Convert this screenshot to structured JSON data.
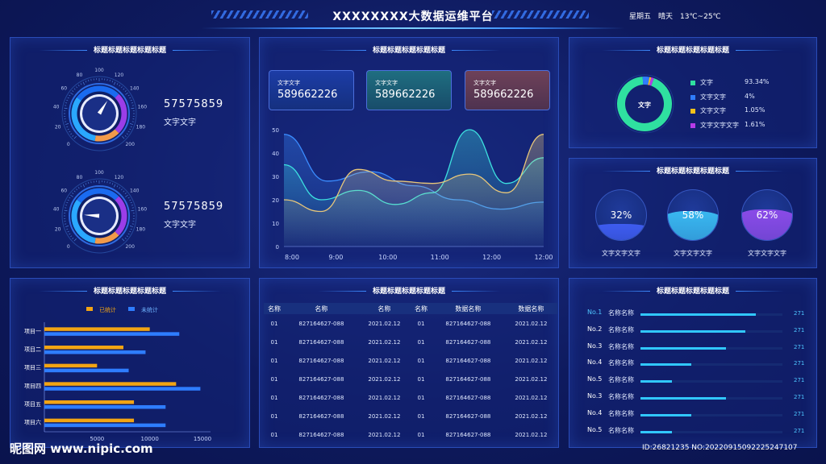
{
  "header": {
    "title": "XXXXXXXX大数据运维平台",
    "date": "星期五　晴天　13℃~25℃"
  },
  "panels": {
    "gauges": {
      "title": "标题标题标题标题标题",
      "items": [
        {
          "value": "57575859",
          "label": "文字文字",
          "needle": 0.62
        },
        {
          "value": "57575859",
          "label": "文字文字",
          "needle": 0.18
        }
      ],
      "ticks": [
        "0",
        "20",
        "40",
        "60",
        "80",
        "100",
        "120",
        "140",
        "160",
        "180",
        "200"
      ]
    },
    "trend": {
      "title": "标题标题标题标题标题",
      "cards": [
        {
          "label": "文字文字",
          "value": "589662226",
          "color": "#1b3aa0"
        },
        {
          "label": "文字文字",
          "value": "589662226",
          "color": "#1c6d7a"
        },
        {
          "label": "文字文字",
          "value": "589662226",
          "color": "#6a3f55"
        }
      ]
    },
    "donut": {
      "title": "标题标题标题标题标题",
      "center": "文字"
    },
    "balls": {
      "title": "标题标题标题标题标题",
      "items": [
        {
          "pct": "32%",
          "value": 0.32,
          "label": "文字文字文字",
          "color": "#3e5cf0"
        },
        {
          "pct": "58%",
          "value": 0.58,
          "label": "文字文字文字",
          "color": "#39b8f0"
        },
        {
          "pct": "62%",
          "value": 0.62,
          "label": "文字文字文字",
          "color": "#8a4be8"
        }
      ]
    },
    "hbar": {
      "title": "标题标题标题标题标题"
    },
    "table": {
      "title": "标题标题标题标题标题",
      "headers": [
        "名称",
        "名称",
        "名称",
        "名称",
        "数据名称",
        "数据名称"
      ],
      "rows": [
        [
          "01",
          "827164627-088",
          "2021.02.12",
          "01",
          "827164627-088",
          "2021.02.12"
        ],
        [
          "01",
          "827164627-088",
          "2021.02.12",
          "01",
          "827164627-088",
          "2021.02.12"
        ],
        [
          "01",
          "827164627-088",
          "2021.02.12",
          "01",
          "827164627-088",
          "2021.02.12"
        ],
        [
          "01",
          "827164627-088",
          "2021.02.12",
          "01",
          "827164627-088",
          "2021.02.12"
        ],
        [
          "01",
          "827164627-088",
          "2021.02.12",
          "01",
          "827164627-088",
          "2021.02.12"
        ],
        [
          "01",
          "827164627-088",
          "2021.02.12",
          "01",
          "827164627-088",
          "2021.02.12"
        ],
        [
          "01",
          "827164627-088",
          "2021.02.12",
          "01",
          "827164627-088",
          "2021.02.12"
        ]
      ]
    },
    "ranking": {
      "title": "标题标题标题标题标题",
      "items": [
        {
          "rank": "No.1",
          "label": "名称名称",
          "value": "271",
          "fill": 0.81,
          "highlight": true
        },
        {
          "rank": "No.2",
          "label": "名称名称",
          "value": "271",
          "fill": 0.74,
          "highlight": false
        },
        {
          "rank": "No.3",
          "label": "名称名称",
          "value": "271",
          "fill": 0.6,
          "highlight": false
        },
        {
          "rank": "No.4",
          "label": "名称名称",
          "value": "271",
          "fill": 0.36,
          "highlight": false
        },
        {
          "rank": "No.5",
          "label": "名称名称",
          "value": "271",
          "fill": 0.22,
          "highlight": false
        },
        {
          "rank": "No.3",
          "label": "名称名称",
          "value": "271",
          "fill": 0.6,
          "highlight": false
        },
        {
          "rank": "No.4",
          "label": "名称名称",
          "value": "271",
          "fill": 0.36,
          "highlight": false
        },
        {
          "rank": "No.5",
          "label": "名称名称",
          "value": "271",
          "fill": 0.22,
          "highlight": false
        }
      ]
    }
  },
  "chart_data": [
    {
      "type": "area",
      "title": "",
      "categories": [
        "8:00",
        "9:00",
        "10:00",
        "11:00",
        "12:00",
        "12:00"
      ],
      "ylim": [
        0,
        50
      ],
      "yticks": [
        "0",
        "10",
        "20",
        "30",
        "40",
        "50"
      ],
      "series": [
        {
          "color": "#3a8cff",
          "values": [
            48,
            28,
            32,
            26,
            20,
            16,
            19
          ]
        },
        {
          "color": "#3de2e0",
          "values": [
            35,
            20,
            24,
            18,
            23,
            50,
            27,
            38
          ]
        },
        {
          "color": "#e8c77a",
          "values": [
            20,
            15,
            33,
            28,
            27,
            31,
            23,
            48
          ]
        }
      ]
    },
    {
      "type": "pie",
      "categories": [
        "文字",
        "文字文字",
        "文字文字",
        "文字文字文字"
      ],
      "labels": [
        "93.34%",
        "4%",
        "1.05%",
        "1.61%"
      ],
      "values": [
        93.34,
        4,
        1.05,
        1.61
      ],
      "colors": [
        "#2fe0a0",
        "#2f7cff",
        "#f4c21a",
        "#b63be8"
      ]
    },
    {
      "type": "bar",
      "orientation": "horizontal",
      "categories": [
        "项目一",
        "项目二",
        "项目三",
        "项目四",
        "项目五",
        "项目六"
      ],
      "series": [
        {
          "name": "已统计",
          "color": "#f2a413",
          "values": [
            10000,
            7500,
            5000,
            12500,
            8500,
            8500
          ]
        },
        {
          "name": "未统计",
          "color": "#2e7dff",
          "values": [
            12800,
            9600,
            8000,
            14800,
            11500,
            11500
          ]
        }
      ],
      "xlim": [
        0,
        15000
      ],
      "xticks": [
        "5000",
        "10000",
        "15000"
      ]
    }
  ],
  "watermark": {
    "site": "昵图网 www.nipic.com",
    "id": "ID:26821235 NO:20220915092225247107"
  }
}
